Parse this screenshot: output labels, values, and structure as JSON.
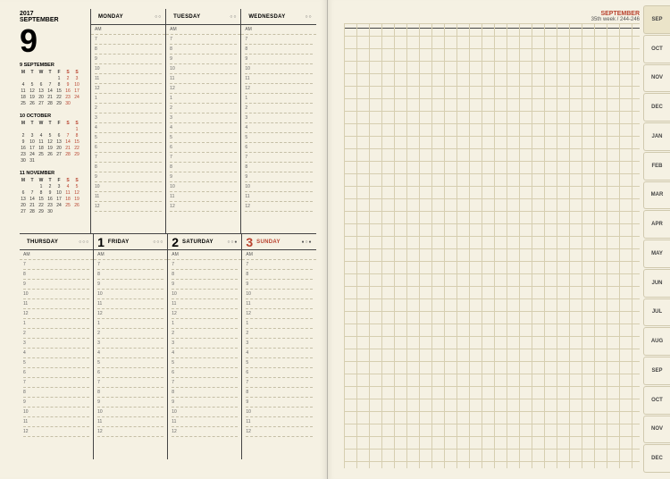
{
  "left": {
    "year": "2017",
    "month_name": "SEPTEMBER",
    "big_num": "9",
    "mini_cals": [
      {
        "title": "9 SEPTEMBER",
        "days": [
          "",
          "",
          "",
          "",
          "1",
          "2",
          "3",
          "4",
          "5",
          "6",
          "7",
          "8",
          "9",
          "10",
          "11",
          "12",
          "13",
          "14",
          "15",
          "16",
          "17",
          "18",
          "19",
          "20",
          "21",
          "22",
          "23",
          "24",
          "25",
          "26",
          "27",
          "28",
          "29",
          "30",
          ""
        ]
      },
      {
        "title": "10 OCTOBER",
        "days": [
          "",
          "",
          "",
          "",
          "",
          "",
          "1",
          "2",
          "3",
          "4",
          "5",
          "6",
          "7",
          "8",
          "9",
          "10",
          "11",
          "12",
          "13",
          "14",
          "15",
          "16",
          "17",
          "18",
          "19",
          "20",
          "21",
          "22",
          "23",
          "24",
          "25",
          "26",
          "27",
          "28",
          "29",
          "30",
          "31",
          "",
          "",
          "",
          "",
          ""
        ]
      },
      {
        "title": "11 NOVEMBER",
        "days": [
          "",
          "",
          "1",
          "2",
          "3",
          "4",
          "5",
          "6",
          "7",
          "8",
          "9",
          "10",
          "11",
          "12",
          "13",
          "14",
          "15",
          "16",
          "17",
          "18",
          "19",
          "20",
          "21",
          "22",
          "23",
          "24",
          "25",
          "26",
          "27",
          "28",
          "29",
          "30",
          "",
          "",
          ""
        ]
      }
    ],
    "dow_heads": [
      "M",
      "T",
      "W",
      "T",
      "F",
      "S",
      "S"
    ],
    "top_days": [
      {
        "num": "",
        "name": "MONDAY",
        "dots": "○○"
      },
      {
        "num": "",
        "name": "TUESDAY",
        "dots": "○○"
      },
      {
        "num": "",
        "name": "WEDNESDAY",
        "dots": "○○"
      }
    ],
    "bottom_days": [
      {
        "num": "",
        "name": "THURSDAY",
        "dots": "○○○"
      },
      {
        "num": "1",
        "name": "FRIDAY",
        "dots": "○○○"
      },
      {
        "num": "2",
        "name": "SATURDAY",
        "dots": "○○●"
      },
      {
        "num": "3",
        "name": "SUNDAY",
        "dots": "●○●",
        "sunday": true
      }
    ],
    "am_label": "AM",
    "hours": [
      "7",
      "8",
      "9",
      "10",
      "11",
      "12",
      "1",
      "2",
      "3",
      "4",
      "5",
      "6",
      "7",
      "8",
      "9",
      "10",
      "11",
      "12"
    ]
  },
  "right": {
    "month": "SEPTEMBER",
    "sub": "35th week / 244-246"
  },
  "tabs": [
    "SEP",
    "OCT",
    "NOV",
    "DEC",
    "JAN",
    "FEB",
    "MAR",
    "APR",
    "MAY",
    "JUN",
    "JUL",
    "AUG",
    "SEP",
    "OCT",
    "NOV",
    "DEC"
  ],
  "active_tab": 0
}
